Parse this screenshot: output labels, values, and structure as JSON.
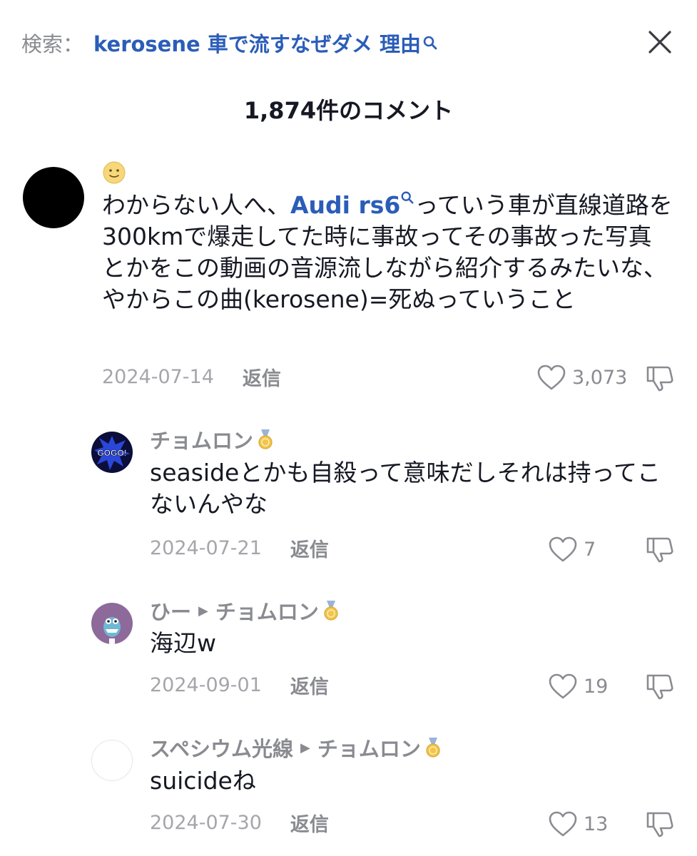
{
  "header": {
    "search_prefix": "検索：",
    "search_query": "kerosene 車で流すなぜダメ 理由",
    "comment_count_title": "1,874件のコメント"
  },
  "comments": [
    {
      "author_emoji": "🙂",
      "text_before": "わからない人へ、",
      "link": "Audi rs6",
      "text_after": "っていう車が直線道路を300kmで爆走してた時に事故ってその事故った写真とかをこの動画の音源流しながら紹介するみたいな、やからこの曲(kerosene)=死ぬっていうこと",
      "date": "2024-07-14",
      "reply_label": "返信",
      "likes": "3,073"
    }
  ],
  "replies": [
    {
      "author": "チョムロン",
      "avatar_text": "GOGO!",
      "text": "seasideとかも自殺って意味だしそれは持ってこないんやな",
      "date": "2024-07-21",
      "reply_label": "返信",
      "likes": "7"
    },
    {
      "author": "ひー",
      "reply_to": "チョムロン",
      "text": "海辺w",
      "date": "2024-09-01",
      "reply_label": "返信",
      "likes": "19"
    },
    {
      "author": "スペシウム光線",
      "reply_to": "チョムロン",
      "text": "suicideね",
      "date": "2024-07-30",
      "reply_label": "返信",
      "likes": "13"
    }
  ]
}
